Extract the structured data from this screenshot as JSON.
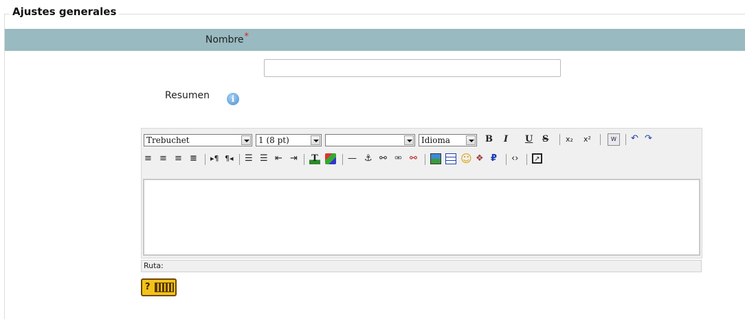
{
  "section": {
    "legend": "Ajustes generales"
  },
  "nombre": {
    "label": "Nombre",
    "required_mark": "*",
    "value": "",
    "placeholder": ""
  },
  "resumen": {
    "label": "Resumen",
    "info_icon": "info-icon"
  },
  "editor": {
    "font_select": "Trebuchet",
    "size_select": "1 (8 pt)",
    "format_select": "",
    "lang_select": "Idioma",
    "bold": "B",
    "italic": "I",
    "underline": "U",
    "strike": "S",
    "subscript": "x₂",
    "superscript": "x²",
    "path_label": "Ruta:"
  },
  "colors": {
    "row_bg": "#98bac0",
    "required": "#e02020",
    "help_bg": "#f3c21a"
  }
}
